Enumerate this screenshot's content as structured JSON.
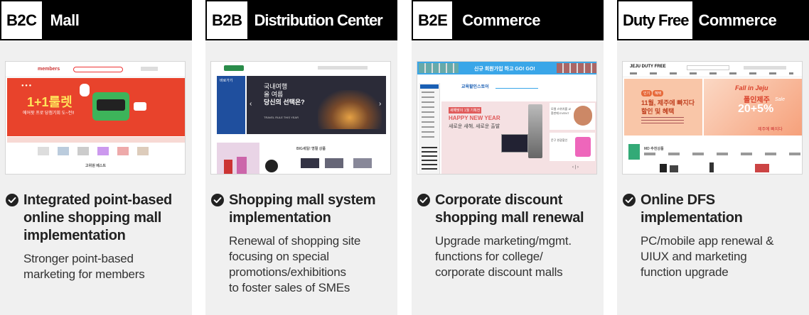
{
  "columns": [
    {
      "tag": "B2C",
      "name": "Mall",
      "title_lines": [
        "Integrated point-based",
        "online shopping mall",
        "implementation"
      ],
      "desc_lines": [
        "Stronger point-based",
        "marketing for members"
      ],
      "shot": {
        "logo": "members",
        "banner_headline": "1+1룰렛",
        "banner_sub": "에어팟 프로 당첨기회 도~전!!",
        "section_label": "고위원 베스트"
      }
    },
    {
      "tag": "B2B",
      "name": "Distribution Center",
      "title_lines": [
        "Shopping mall system",
        "implementation"
      ],
      "desc_lines": [
        "Renewal of shopping site",
        "focusing on special",
        "promotions/exhibitions",
        "to foster sales of SMEs"
      ],
      "shot": {
        "banner_line1": "국내여행",
        "banner_line2": "올 여름",
        "banner_line3": "당신의 선택은?",
        "banner_small": "TRAVEL RULE THIS YEAR",
        "section_label": "BIG세일! 명절 상품",
        "left_label": "바로가기"
      }
    },
    {
      "tag": "B2E",
      "name": "Commerce",
      "title_lines": [
        "Corporate discount",
        "shopping mall renewal"
      ],
      "desc_lines": [
        "Upgrade marketing/mgmt.",
        "functions for college/",
        "corporate discount malls"
      ],
      "shot": {
        "topbar": "신규 회원가입 하고 GO! GO!",
        "logo": "교육할인스토어",
        "banner_tag": "새해맞이 1월 기획전",
        "banner_line1": "HAPPY NEW YEAR",
        "banner_line2": "새로운 새해, 새로운 출발",
        "side1": "모델 스위치를 교환판매 EVENT",
        "side2": "문구 완광할인"
      }
    },
    {
      "tag": "Duty Free",
      "name": "Commerce",
      "title_lines": [
        "Online DFS",
        "implementation"
      ],
      "desc_lines": [
        "PC/mobile app renewal &",
        "UIUX and marketing",
        "function upgrade"
      ],
      "shot": {
        "logo": "JEJU DUTY FREE",
        "badge1": "인기",
        "badge2": "혜택",
        "banner_line1": "11월, 제주에 빠지다",
        "banner_line2": "할인 및 혜택",
        "right_line1": "Fall in Jeju",
        "right_line2": "폴인제주",
        "right_line3": "20+5%",
        "right_line4": "Sale",
        "right_line5": "제주에 빠지다",
        "section_label": "MD 추천상품"
      }
    }
  ],
  "colors": {
    "header_bg": "#000000",
    "panel_bg": "#f0f0f0",
    "text_dark": "#222222",
    "b2c_banner": "#e8432c",
    "b2b_banner": "#2b2b38",
    "b2e_banner": "#f5e1e3",
    "dfs_banner": "#f9c6a8"
  },
  "icons": {
    "check": "check-circle-icon"
  }
}
